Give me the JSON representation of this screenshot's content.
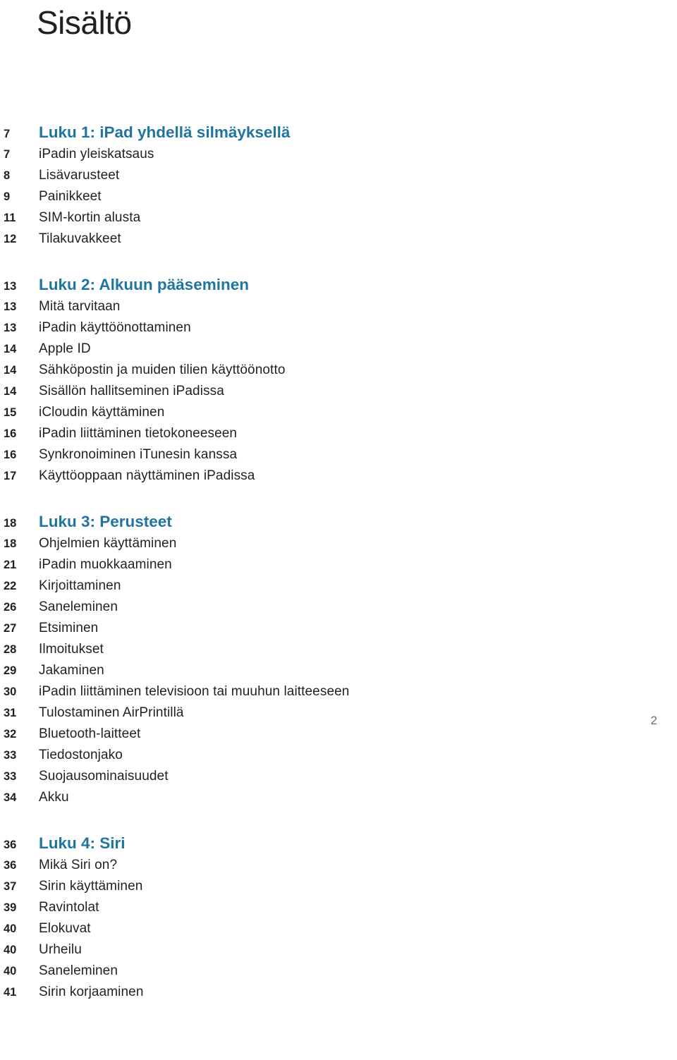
{
  "page": {
    "title": "Sisältö",
    "folio": "2",
    "accent_color": "#1f74a0",
    "text_color": "#231f20",
    "background_color": "#ffffff"
  },
  "toc": {
    "sections": [
      {
        "chapter": {
          "page": "7",
          "label": "Luku 1: iPad yhdellä silmäyksellä"
        },
        "entries": [
          {
            "page": "7",
            "label": "iPadin yleiskatsaus"
          },
          {
            "page": "8",
            "label": "Lisävarusteet"
          },
          {
            "page": "9",
            "label": "Painikkeet"
          },
          {
            "page": "11",
            "label": "SIM-kortin alusta"
          },
          {
            "page": "12",
            "label": "Tilakuvakkeet"
          }
        ]
      },
      {
        "chapter": {
          "page": "13",
          "label": "Luku 2: Alkuun pääseminen"
        },
        "entries": [
          {
            "page": "13",
            "label": "Mitä tarvitaan"
          },
          {
            "page": "13",
            "label": "iPadin käyttöönottaminen"
          },
          {
            "page": "14",
            "label": "Apple ID"
          },
          {
            "page": "14",
            "label": "Sähköpostin ja muiden tilien käyttöönotto"
          },
          {
            "page": "14",
            "label": "Sisällön hallitseminen iPadissa"
          },
          {
            "page": "15",
            "label": "iCloudin käyttäminen"
          },
          {
            "page": "16",
            "label": "iPadin liittäminen tietokoneeseen"
          },
          {
            "page": "16",
            "label": "Synkronoiminen iTunesin kanssa"
          },
          {
            "page": "17",
            "label": "Käyttöoppaan näyttäminen iPadissa"
          }
        ]
      },
      {
        "chapter": {
          "page": "18",
          "label": "Luku 3: Perusteet"
        },
        "entries": [
          {
            "page": "18",
            "label": "Ohjelmien käyttäminen"
          },
          {
            "page": "21",
            "label": "iPadin muokkaaminen"
          },
          {
            "page": "22",
            "label": "Kirjoittaminen"
          },
          {
            "page": "26",
            "label": "Saneleminen"
          },
          {
            "page": "27",
            "label": "Etsiminen"
          },
          {
            "page": "28",
            "label": "Ilmoitukset"
          },
          {
            "page": "29",
            "label": "Jakaminen"
          },
          {
            "page": "30",
            "label": "iPadin liittäminen televisioon tai muuhun laitteeseen"
          },
          {
            "page": "31",
            "label": "Tulostaminen AirPrintillä"
          },
          {
            "page": "32",
            "label": "Bluetooth-laitteet"
          },
          {
            "page": "33",
            "label": "Tiedostonjako"
          },
          {
            "page": "33",
            "label": "Suojausominaisuudet"
          },
          {
            "page": "34",
            "label": "Akku"
          }
        ]
      },
      {
        "chapter": {
          "page": "36",
          "label": "Luku 4: Siri"
        },
        "entries": [
          {
            "page": "36",
            "label": "Mikä Siri on?"
          },
          {
            "page": "37",
            "label": "Sirin käyttäminen"
          },
          {
            "page": "39",
            "label": "Ravintolat"
          },
          {
            "page": "40",
            "label": "Elokuvat"
          },
          {
            "page": "40",
            "label": "Urheilu"
          },
          {
            "page": "40",
            "label": "Saneleminen"
          },
          {
            "page": "41",
            "label": "Sirin korjaaminen"
          }
        ]
      }
    ]
  }
}
